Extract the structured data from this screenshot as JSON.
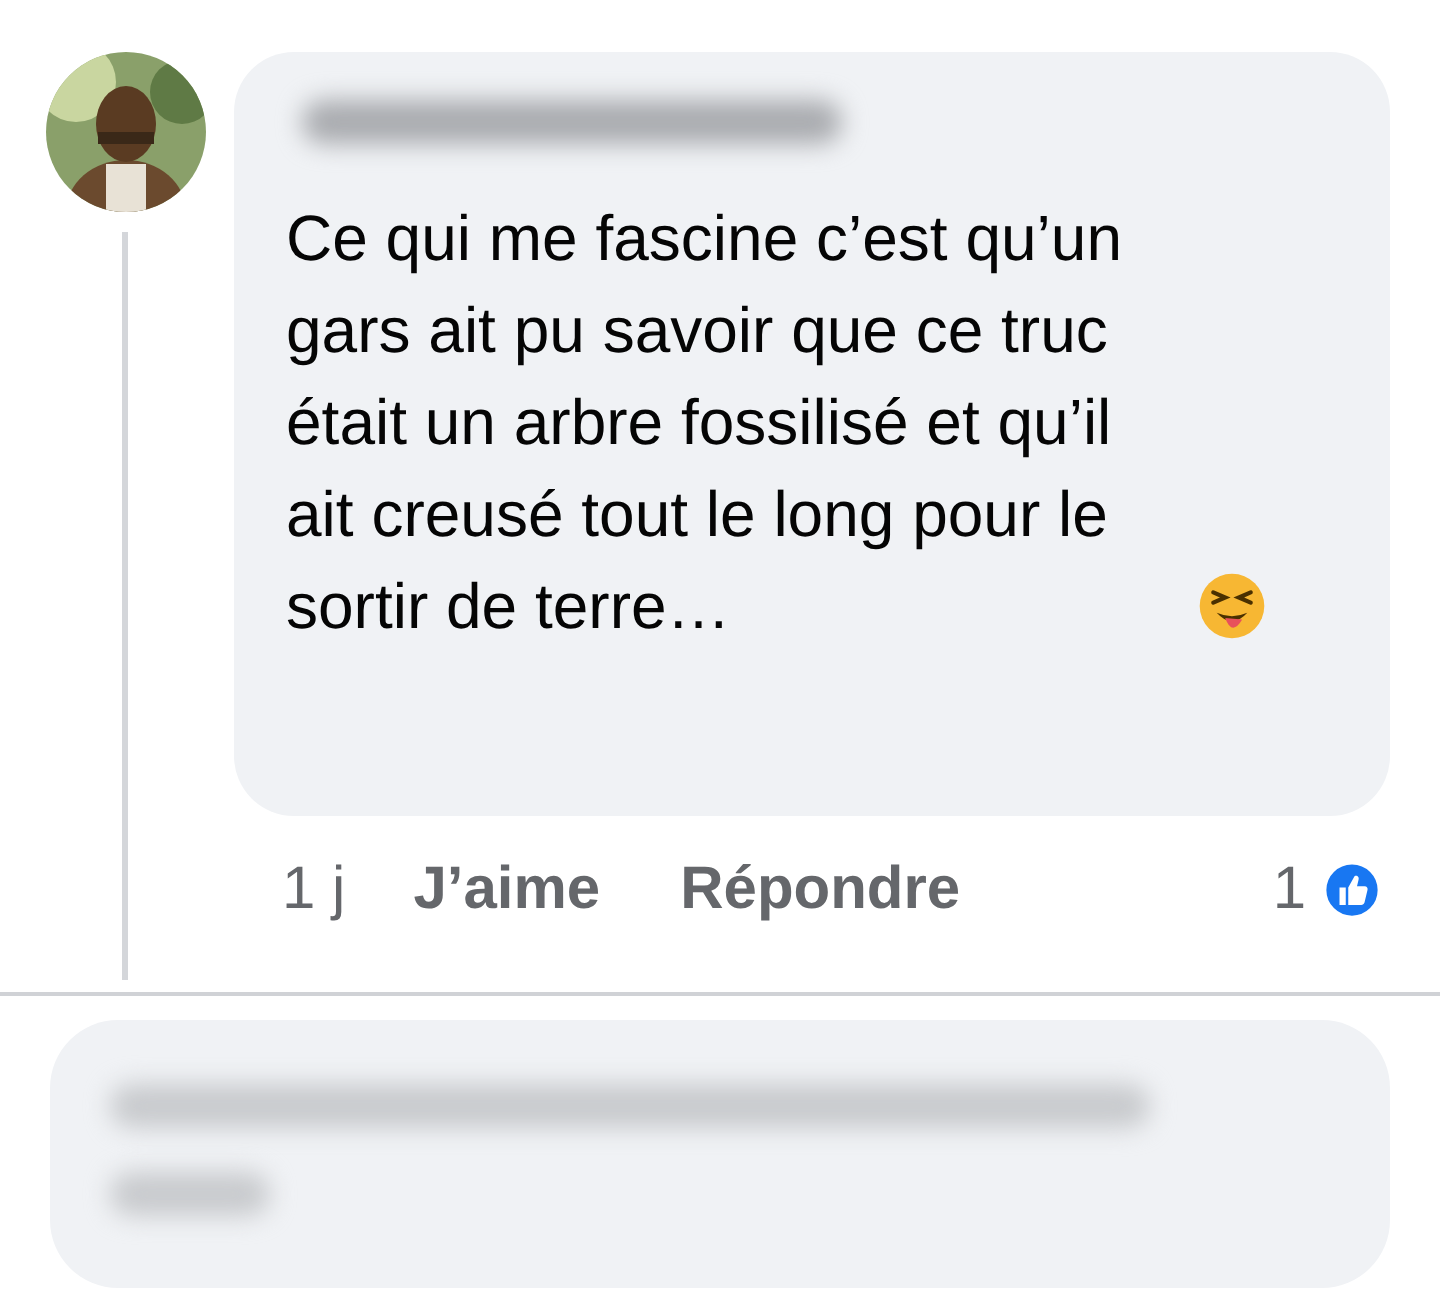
{
  "comment": {
    "text": "Ce qui me fascine c’est qu’un gars ait pu savoir que ce truc était un arbre fossilisé et qu’il ait creusé tout le long pour le sortir de terre…",
    "age": "1 j",
    "actions": [
      {
        "label": "J’aime"
      },
      {
        "label": "Répondre"
      }
    ],
    "reaction_count": "1"
  }
}
